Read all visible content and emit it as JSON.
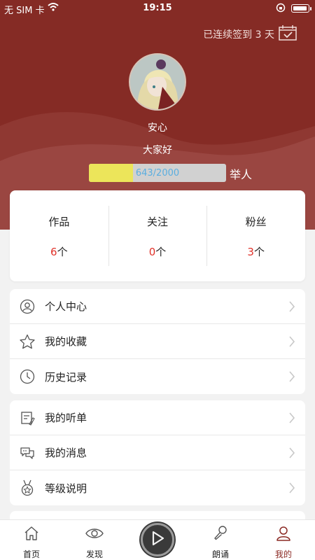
{
  "status_bar": {
    "carrier": "无 SIM 卡",
    "time": "19:15"
  },
  "header": {
    "checkin_text": "已连续签到 3 天",
    "username": "安心",
    "signature": "大家好",
    "level": {
      "progress_text": "643/2000",
      "progress_fraction": 0.3215,
      "title": "举人"
    }
  },
  "stats": [
    {
      "label": "作品",
      "value": "6",
      "unit": "个"
    },
    {
      "label": "关注",
      "value": "0",
      "unit": "个"
    },
    {
      "label": "粉丝",
      "value": "3",
      "unit": "个"
    }
  ],
  "menu_group_1": [
    {
      "label": "个人中心",
      "icon": "person-circle-icon"
    },
    {
      "label": "我的收藏",
      "icon": "star-icon"
    },
    {
      "label": "历史记录",
      "icon": "clock-icon"
    }
  ],
  "menu_group_2": [
    {
      "label": "我的听单",
      "icon": "playlist-icon"
    },
    {
      "label": "我的消息",
      "icon": "chat-bubbles-icon"
    },
    {
      "label": "等级说明",
      "icon": "medal-icon"
    }
  ],
  "tabbar": [
    {
      "label": "首页",
      "icon": "home-icon"
    },
    {
      "label": "发现",
      "icon": "eye-icon"
    },
    {
      "label": "",
      "icon": "play-icon"
    },
    {
      "label": "朗诵",
      "icon": "microphone-icon"
    },
    {
      "label": "我的",
      "icon": "person-icon",
      "active": true
    }
  ],
  "colors": {
    "header_bg": "#852b25",
    "accent_red": "#e0322a",
    "active_tab": "#8b2a24",
    "level_fill": "#ece55a",
    "level_text": "#5aaee0"
  }
}
